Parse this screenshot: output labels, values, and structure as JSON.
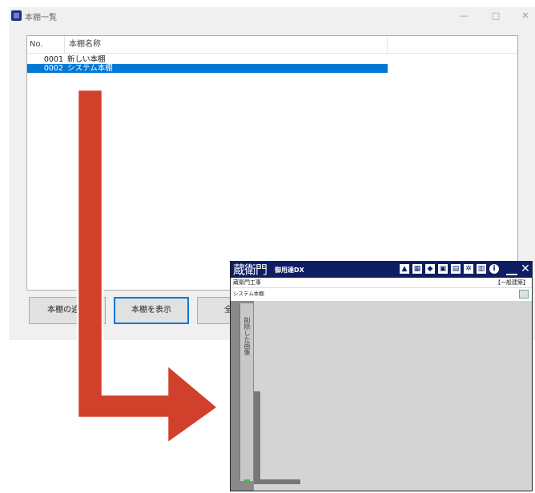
{
  "window": {
    "title": "本棚一覧",
    "controls": {
      "minimize": "—",
      "maximize": "□",
      "close": "✕"
    }
  },
  "list": {
    "columns": [
      "No.",
      "本棚名称"
    ],
    "rows": [
      {
        "no": "0001",
        "name": "新しい本棚",
        "selected": false
      },
      {
        "no": "0002",
        "name": "システム本棚",
        "selected": true
      }
    ],
    "selection_color": "#0078d7"
  },
  "buttons": {
    "add": "本棚の追加",
    "show": "本棚を表示",
    "third_partial": "全"
  },
  "inset_app": {
    "logo": "蔵衛門",
    "logo_sub": "御用達DX",
    "toolbar_icons": [
      "upload-icon",
      "gallery-icon",
      "compare-icon",
      "photo-icon",
      "folder-icon",
      "settings-icon",
      "book-icon",
      "info-icon"
    ],
    "project_name": "蔵衛門工事",
    "kind_label": "【一般建築】",
    "shelf_label": "システム本棚",
    "spine_text": "削除した画像",
    "header_color": "#0f1d63"
  },
  "arrow_color": "#d0402a"
}
